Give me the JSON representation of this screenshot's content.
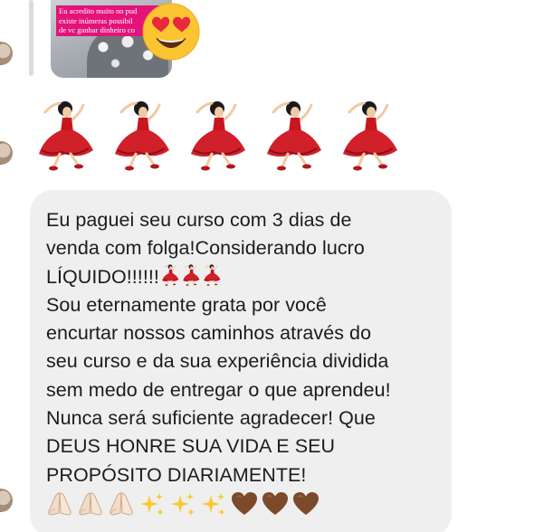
{
  "story_reply": {
    "caption": "Eu acredito muito no pud\nexiste inúmeras possibil\nde vc ganhar dinheiro co"
  },
  "reactions": {
    "reaction_icon": "heart-eyes-face-icon",
    "dancer_count": 5,
    "dancer_icon": "flamenco-dancer-icon"
  },
  "message": {
    "lines": [
      "Eu paguei seu curso com 3 dias de",
      "venda com folga!Considerando lucro",
      "LÍQUIDO!!!!!!",
      "Sou eternamente grata por você",
      "encurtar nossos caminhos através do",
      "seu curso e da sua experiência dividida",
      "sem medo de entregar o que aprendeu!",
      "Nunca será suficiente agradecer! Que",
      "DEUS HONRE SUA VIDA E SEU",
      "PROPÓSITO DIARIAMENTE!"
    ],
    "inline_emoji": "flamenco-dancer-icon",
    "inline_emoji_count": 3,
    "end_emojis": [
      "folded-hands-icon",
      "folded-hands-icon",
      "folded-hands-icon",
      "sparkles-icon",
      "sparkles-icon",
      "sparkles-icon",
      "brown-heart-icon",
      "brown-heart-icon",
      "brown-heart-icon"
    ]
  },
  "colors": {
    "bubble": "#efeff0",
    "caption_bg": "#e3137a",
    "text": "#1c1c1e",
    "heart": "#7b4a2a",
    "dress": "#d0202a"
  }
}
